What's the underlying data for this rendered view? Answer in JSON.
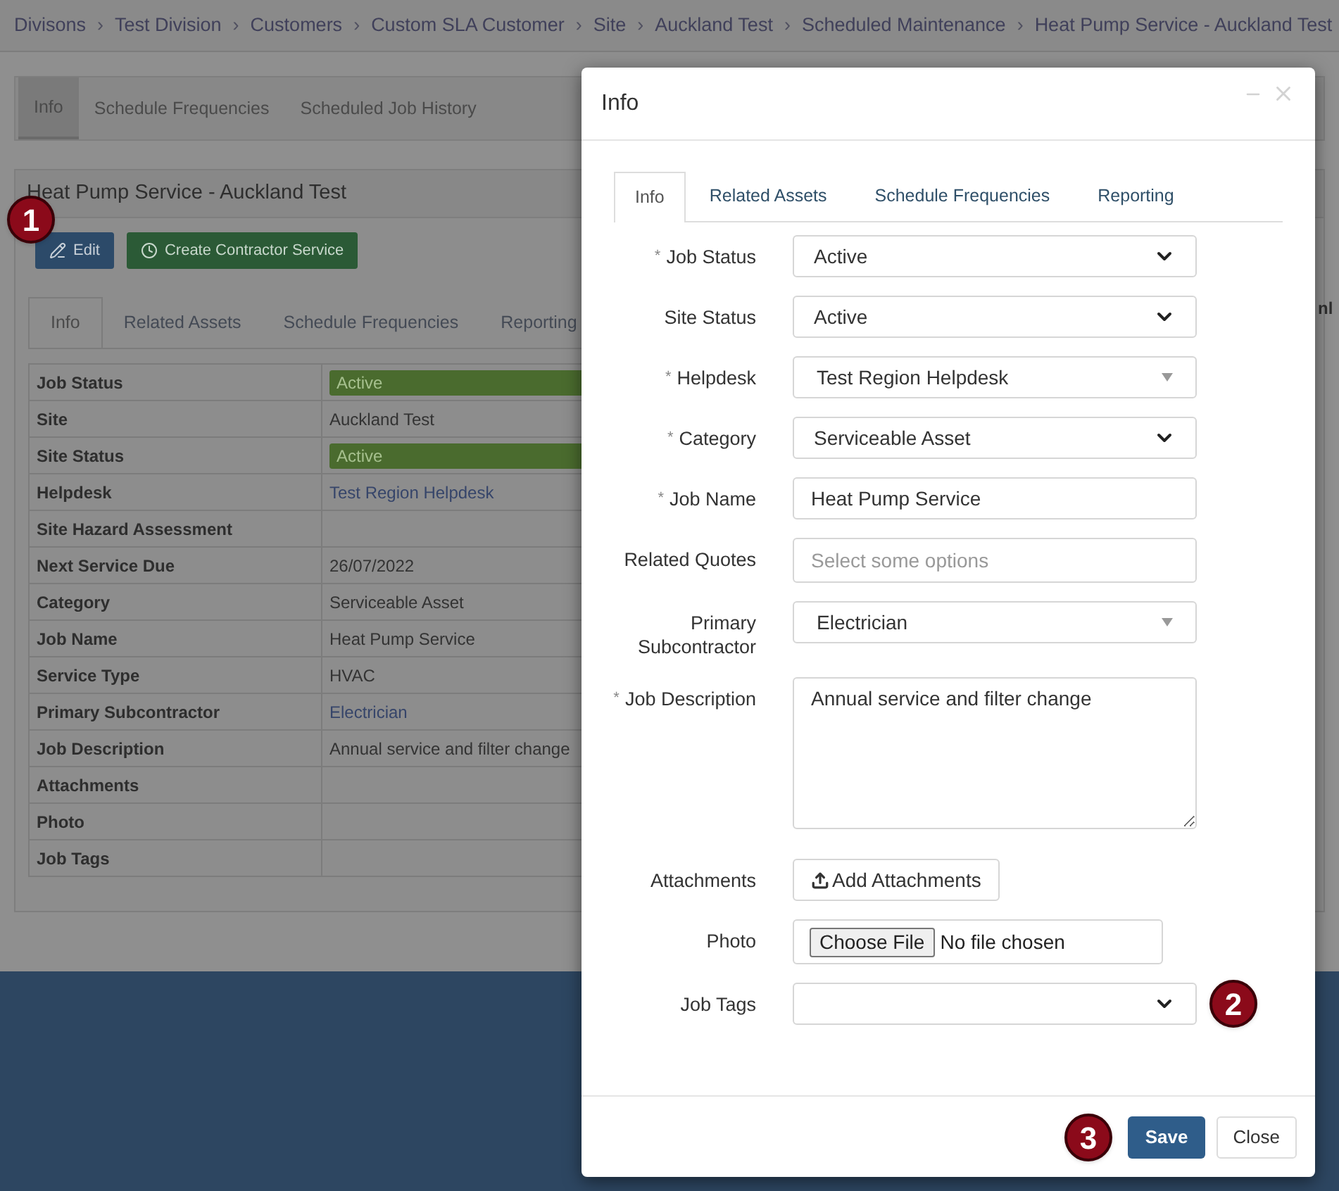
{
  "breadcrumbs": [
    "Divisons",
    "Test Division",
    "Customers",
    "Custom SLA Customer",
    "Site",
    "Auckland Test",
    "Scheduled Maintenance",
    "Heat Pump Service - Auckland Test"
  ],
  "breadcrumb_separators": [
    "›",
    "›",
    "›",
    "›",
    "›",
    "›",
    "›"
  ],
  "page_tabs": [
    {
      "label": "Info",
      "selected": true
    },
    {
      "label": "Schedule Frequencies",
      "selected": false
    },
    {
      "label": "Scheduled Job History",
      "selected": false
    }
  ],
  "record": {
    "title": "Heat Pump Service - Auckland Test",
    "actions": [
      {
        "label": "Edit",
        "kind": "edit"
      },
      {
        "label": "Create Contractor Service",
        "kind": "contractor"
      }
    ],
    "tabs": [
      {
        "label": "Info",
        "selected": true
      },
      {
        "label": "Related Assets",
        "selected": false
      },
      {
        "label": "Schedule Frequencies",
        "selected": false
      },
      {
        "label": "Reporting",
        "selected": false
      }
    ],
    "rows": [
      {
        "label": "Job Status",
        "value": "Active",
        "kind": "badge"
      },
      {
        "label": "Site",
        "value": "Auckland Test",
        "kind": "text"
      },
      {
        "label": "Site Status",
        "value": "Active",
        "kind": "badge"
      },
      {
        "label": "Helpdesk",
        "value": "Test Region Helpdesk",
        "kind": "link"
      },
      {
        "label": "Site Hazard Assessment"
      },
      {
        "label": "Next Service Due",
        "value": "26/07/2022",
        "kind": "text"
      },
      {
        "label": "Category",
        "value": "Serviceable Asset",
        "kind": "text"
      },
      {
        "label": "Job Name",
        "value": "Heat Pump Service",
        "kind": "text"
      },
      {
        "label": "Service Type",
        "value": "HVAC",
        "kind": "text"
      },
      {
        "label": "Primary Subcontractor",
        "value": "Electrician",
        "kind": "link"
      },
      {
        "label": "Job Description",
        "value": "Annual service and filter change",
        "kind": "text"
      },
      {
        "label": "Attachments"
      },
      {
        "label": "Photo"
      },
      {
        "label": "Job Tags"
      }
    ],
    "side_fragment": "nl"
  },
  "modal": {
    "title": "Info",
    "tabs": [
      {
        "label": "Info",
        "selected": true
      },
      {
        "label": "Related Assets",
        "selected": false
      },
      {
        "label": "Schedule Frequencies",
        "selected": false
      },
      {
        "label": "Reporting",
        "selected": false
      }
    ],
    "fields": [
      {
        "label": "Job Status",
        "asterisk": "*",
        "kind": "select",
        "value": "Active"
      },
      {
        "label": "Site Status",
        "kind": "select",
        "value": "Active"
      },
      {
        "label": "Helpdesk",
        "asterisk": "*",
        "kind": "combo",
        "value": "Test Region Helpdesk"
      },
      {
        "label": "Category",
        "asterisk": "*",
        "kind": "select",
        "value": "Serviceable Asset"
      },
      {
        "label": "Job Name",
        "asterisk": "*",
        "kind": "text",
        "value": "Heat Pump Service"
      },
      {
        "label": "Related Quotes",
        "kind": "multiselect",
        "placeholder": "Select some options"
      },
      {
        "label": "Primary Subcontractor",
        "kind": "combo",
        "value": "Electrician"
      },
      {
        "label": "Job Description",
        "asterisk": "*",
        "kind": "textarea",
        "value": "Annual service and filter change"
      },
      {
        "label": "Attachments",
        "kind": "button",
        "value": "Add Attachments"
      },
      {
        "label": "Photo",
        "kind": "file",
        "value": "Choose File",
        "note": "No file chosen"
      },
      {
        "label": "Job Tags",
        "kind": "select"
      }
    ],
    "buttons": [
      {
        "label": "Save",
        "kind": "primary"
      },
      {
        "label": "Close",
        "kind": "default"
      }
    ]
  },
  "markers": [
    "1",
    "2",
    "3"
  ]
}
